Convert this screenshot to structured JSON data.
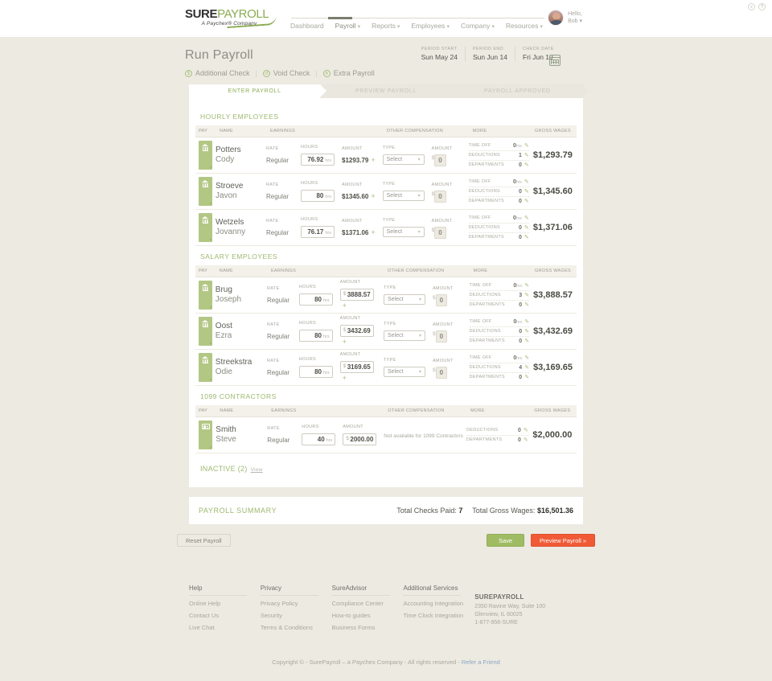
{
  "brand": {
    "name_bold": "SURE",
    "name_light": "PAYROLL",
    "tagline": "A Paychex® Company"
  },
  "nav": {
    "items": [
      {
        "label": "Dashboard",
        "caret": ""
      },
      {
        "label": "Payroll",
        "caret": "▾"
      },
      {
        "label": "Reports",
        "caret": "▾"
      },
      {
        "label": "Employees",
        "caret": "▾"
      },
      {
        "label": "Company",
        "caret": "▾"
      },
      {
        "label": "Resources",
        "caret": "▾"
      }
    ],
    "active": "Payroll"
  },
  "topright": {
    "search_glyph": "⌕",
    "help_glyph": "?",
    "greeting_line1": "Hello,",
    "greeting_line2": "Bob ▾"
  },
  "header": {
    "title": "Run Payroll",
    "dates": [
      {
        "label": "PERIOD START",
        "value": "Sun May 24"
      },
      {
        "label": "PERIOD END",
        "value": "Sun Jun 14"
      },
      {
        "label": "CHECK DATE",
        "value": "Fri Jun 19"
      }
    ],
    "quick_links": [
      {
        "glyph": "$",
        "label": "Additional Check"
      },
      {
        "glyph": "↺",
        "label": "Void Check"
      },
      {
        "glyph": "✕",
        "label": "Extra Payroll"
      }
    ],
    "separator": "|"
  },
  "stepper": [
    {
      "label": "ENTER PAYROLL",
      "state": "active"
    },
    {
      "label": "PREVIEW PAYROLL",
      "state": "dim"
    },
    {
      "label": "PAYROLL APPROVED",
      "state": "dim"
    }
  ],
  "columns": {
    "pay": "PAY",
    "name": "NAME",
    "earnings": "EARNINGS",
    "other_comp": "OTHER COMPENSATION",
    "more": "MORE",
    "gross": "GROSS WAGES",
    "rate": "RATE",
    "hours": "HOURS",
    "amount": "AMOUNT",
    "type": "TYPE",
    "oc_amount": "AMOUNT",
    "time_off": "TIME OFF",
    "deductions": "DEDUCTIONS",
    "departments": "DEPARTMENTS"
  },
  "labels": {
    "regular": "Regular",
    "select": "Select",
    "hrs_unit": "hrs",
    "dollar": "$",
    "plus": "+",
    "pencil": "✎",
    "caret": "▾",
    "not_available_1099": "Not available for 1099 Contractors"
  },
  "sections": [
    {
      "title": "HOURLY EMPLOYEES",
      "pay_icon": "bank-icon",
      "rows": [
        {
          "last": "Potters",
          "first": "Cody",
          "rate": "Regular",
          "hours": "76.92",
          "amount": "$1293.79",
          "amount_has_prefix": false,
          "oc_type": "Select",
          "oc_amount": "0",
          "time_off": "0",
          "deductions": "1",
          "departments": "0",
          "gross": "$1,293.79"
        },
        {
          "last": "Stroeve",
          "first": "Javon",
          "rate": "Regular",
          "hours": "80",
          "amount": "$1345.60",
          "amount_has_prefix": false,
          "oc_type": "Select",
          "oc_amount": "0",
          "time_off": "0",
          "deductions": "0",
          "departments": "0",
          "gross": "$1,345.60"
        },
        {
          "last": "Wetzels",
          "first": "Jovanny",
          "rate": "Regular",
          "hours": "76.17",
          "amount": "$1371.06",
          "amount_has_prefix": false,
          "oc_type": "Select",
          "oc_amount": "0",
          "time_off": "0",
          "deductions": "0",
          "departments": "0",
          "gross": "$1,371.06"
        }
      ]
    },
    {
      "title": "SALARY EMPLOYEES",
      "pay_icon": "bank-icon",
      "rows": [
        {
          "last": "Brug",
          "first": "Joseph",
          "rate": "Regular",
          "hours": "80",
          "amount": "3888.57",
          "amount_has_prefix": true,
          "oc_type": "Select",
          "oc_amount": "0",
          "time_off": "0",
          "deductions": "3",
          "departments": "0",
          "gross": "$3,888.57"
        },
        {
          "last": "Oost",
          "first": "Ezra",
          "rate": "Regular",
          "hours": "80",
          "amount": "3432.69",
          "amount_has_prefix": true,
          "oc_type": "Select",
          "oc_amount": "0",
          "time_off": "0",
          "deductions": "0",
          "departments": "0",
          "gross": "$3,432.69"
        },
        {
          "last": "Streekstra",
          "first": "Odie",
          "rate": "Regular",
          "hours": "80",
          "amount": "3169.65",
          "amount_has_prefix": true,
          "oc_type": "Select",
          "oc_amount": "0",
          "time_off": "0",
          "deductions": "4",
          "departments": "0",
          "gross": "$3,169.65"
        }
      ]
    },
    {
      "title": "1099 CONTRACTORS",
      "pay_icon": "check-card-icon",
      "contractor": true,
      "rows": [
        {
          "last": "Smith",
          "first": "Steve",
          "rate": "Regular",
          "hours": "40",
          "amount": "2000.00",
          "amount_has_prefix": true,
          "deductions": "0",
          "departments": "0",
          "gross": "$2,000.00"
        }
      ]
    }
  ],
  "inactive": {
    "label": "INACTIVE (2)",
    "view": "View"
  },
  "summary": {
    "title": "PAYROLL SUMMARY",
    "checks_label": "Total Checks Paid:",
    "checks_value": "7",
    "gross_label": "Total Gross Wages:",
    "gross_value": "$16,501.36"
  },
  "buttons": {
    "reset": "Reset Payroll",
    "save": "Save",
    "preview": "Preview Payroll »"
  },
  "footer": {
    "columns": [
      {
        "heading": "Help",
        "links": [
          "Online Help",
          "Contact Us",
          "Live Chat"
        ]
      },
      {
        "heading": "Privacy",
        "links": [
          "Privacy Policy",
          "Security",
          "Terms & Conditions"
        ]
      },
      {
        "heading": "SureAdvisor",
        "links": [
          "Compliance Center",
          "How-to guides",
          "Business Forms"
        ]
      },
      {
        "heading": "Additional Services",
        "links": [
          "Accounting Integration",
          "Time Clock Integration"
        ]
      }
    ],
    "company": {
      "name": "SUREPAYROLL",
      "address1": "2350 Ravine Way, Suite 100",
      "address2": "Glenview, IL 60025",
      "phone": "1-877-956-SURE"
    },
    "copyright": "Copyright © - SurePayroll – a Paychex Company - All rights reserved - ",
    "refer": "Refer a Friend"
  },
  "colors": {
    "page_bg": "#edeae2",
    "accent_green": "#9eb86e",
    "pay_icon_green": "#b3c784",
    "save_green": "#9fbb63",
    "preview_orange": "#f05a36",
    "text_dark": "#4b4a43"
  }
}
